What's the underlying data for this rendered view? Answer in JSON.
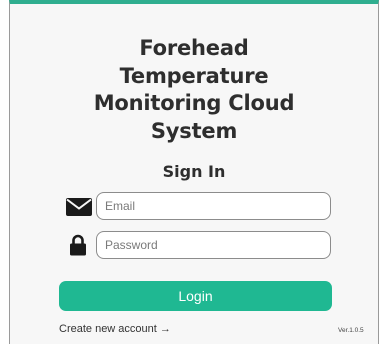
{
  "app": {
    "title_lines": [
      "Forehead",
      "Temperature",
      "Monitoring Cloud",
      "System"
    ],
    "subtitle": "Sign In",
    "version": "Ver.1.0.5"
  },
  "form": {
    "email": {
      "value": "",
      "placeholder": "Email",
      "icon": "envelope-icon"
    },
    "password": {
      "value": "",
      "placeholder": "Password",
      "icon": "lock-icon"
    },
    "login_label": "Login"
  },
  "links": {
    "create_account": "Create new account →"
  },
  "colors": {
    "accent": "#1fb892",
    "top_border": "#2fae8f",
    "text": "#2e2e2e",
    "background": "#f7f7f7"
  }
}
